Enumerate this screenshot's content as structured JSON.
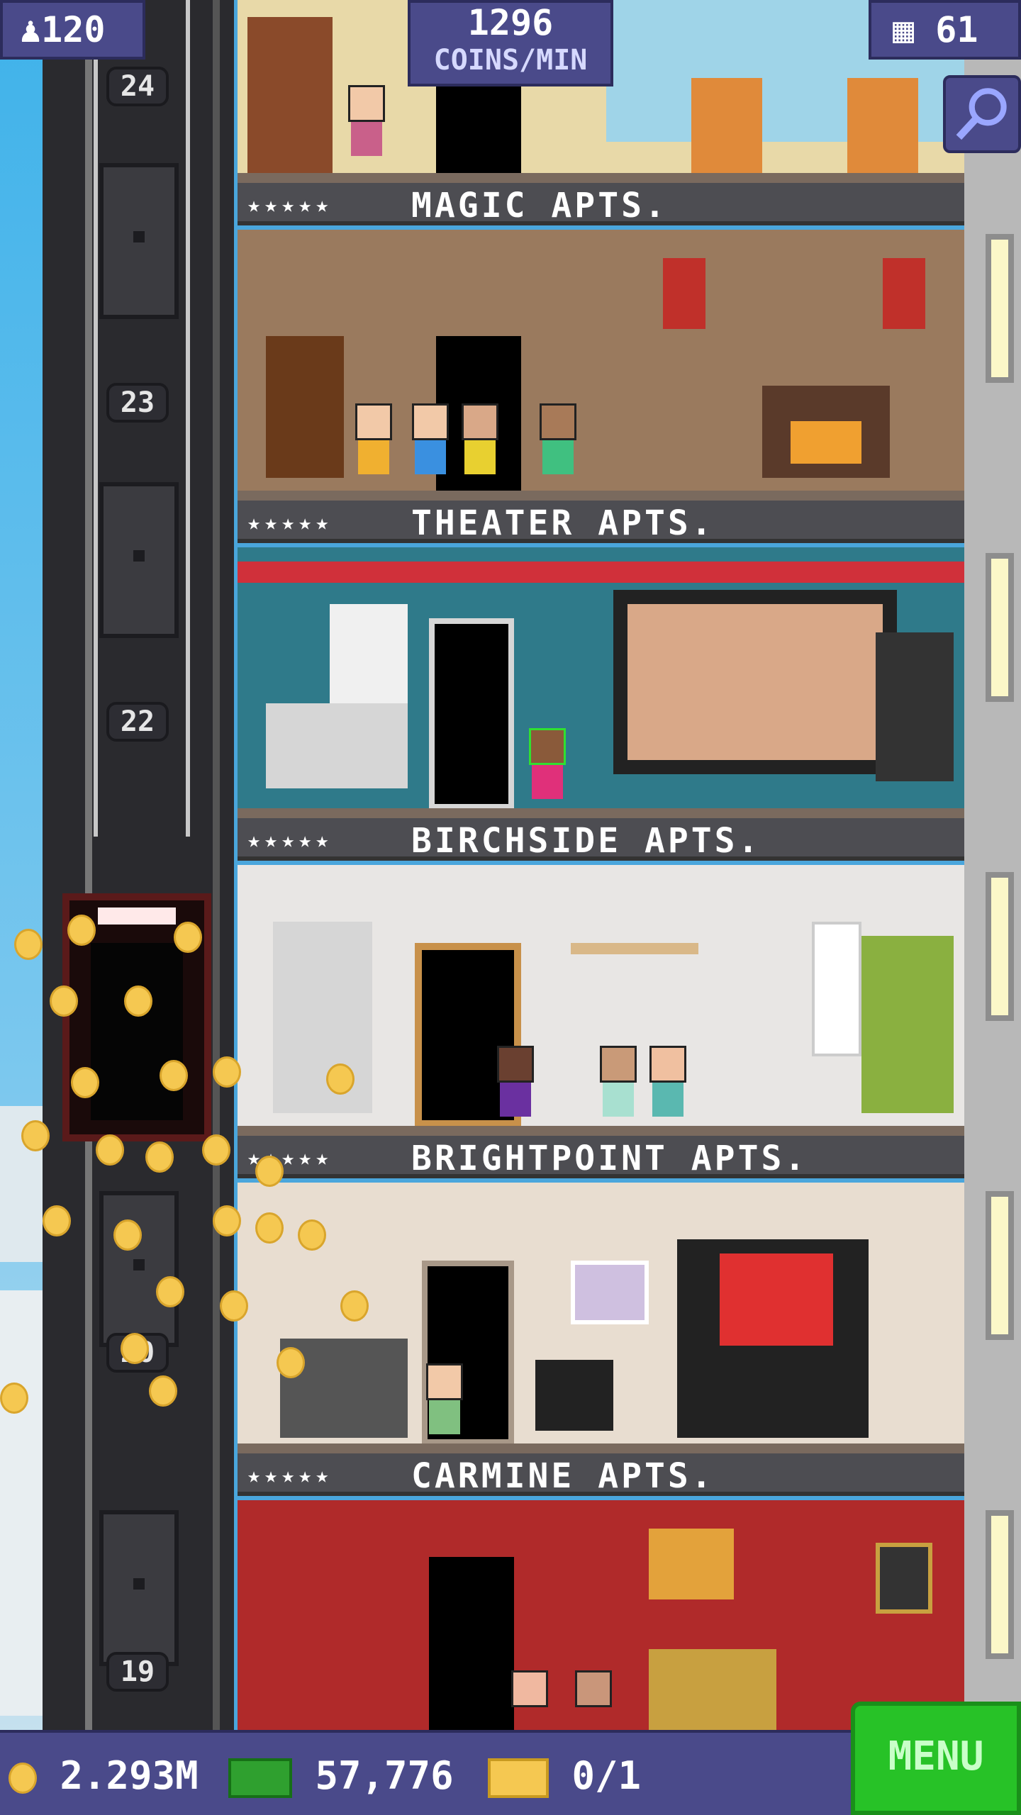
{
  "hud": {
    "population": "120",
    "coins_per_min_value": "1296",
    "coins_per_min_label": "COINS/MIN",
    "floors": "61"
  },
  "shaft": {
    "floor_numbers": [
      "24",
      "23",
      "22",
      "20",
      "19"
    ]
  },
  "floors": [
    {
      "name": "MAGIC APTS.",
      "stars": "★★★★★"
    },
    {
      "name": "THEATER APTS.",
      "stars": "★★★★★"
    },
    {
      "name": "BIRCHSIDE APTS.",
      "stars": "★★★★★"
    },
    {
      "name": "BRIGHTPOINT APTS.",
      "stars": "★★★★★"
    },
    {
      "name": "CARMINE APTS.",
      "stars": "★★★★★"
    }
  ],
  "bottom": {
    "coins": "2.293M",
    "bux": "57,776",
    "tickets": "0/1",
    "menu_label": "MENU"
  },
  "colors": {
    "hud_bg": "#4a4a8a",
    "menu_green": "#27c227",
    "coin_gold": "#f5c851"
  }
}
